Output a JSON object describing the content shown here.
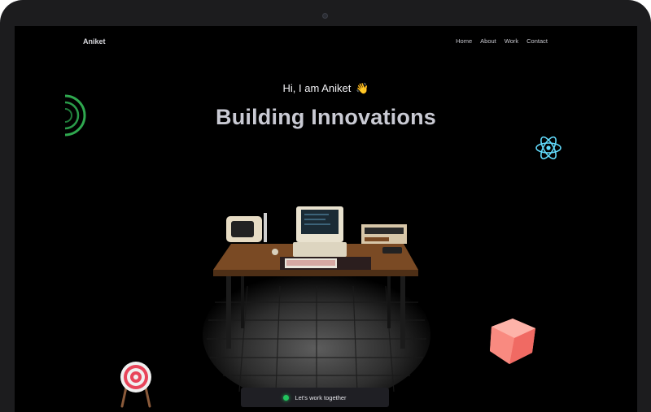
{
  "header": {
    "logo": "Aniket"
  },
  "nav": {
    "items": [
      {
        "label": "Home"
      },
      {
        "label": "About"
      },
      {
        "label": "Work"
      },
      {
        "label": "Contact"
      }
    ]
  },
  "hero": {
    "greeting": "Hi, I am Aniket",
    "wave": "👋",
    "headline": "Building Innovations"
  },
  "cta": {
    "label": "Let's work together",
    "status_color": "#22c55e"
  },
  "icons": {
    "decor_left": "ring-icon",
    "decor_right": "react-icon",
    "decor_bottom_left": "target-icon",
    "decor_bottom_right": "cube-icon"
  },
  "colors": {
    "background": "#000000",
    "headline": "#c9cad3",
    "accent_green": "#22c55e",
    "react_blue": "#61dafb",
    "cube_pink": "#f87f78"
  }
}
